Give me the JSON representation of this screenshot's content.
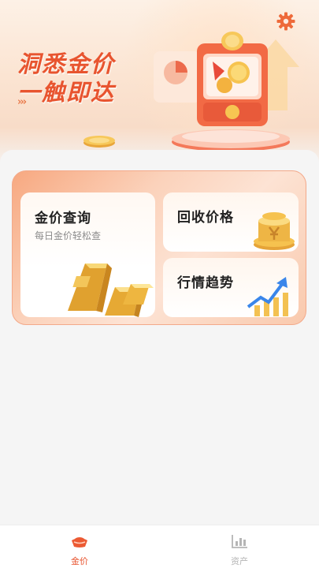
{
  "hero": {
    "title_line1": "洞悉金价",
    "title_line2": "一触即达",
    "arrows": "›››"
  },
  "tiles": {
    "gold_price": {
      "title": "金价查询",
      "subtitle": "每日金价轻松查"
    },
    "recycle": {
      "title": "回收价格"
    },
    "trend": {
      "title": "行情趋势"
    }
  },
  "tabbar": {
    "tabs": [
      {
        "label": "金价",
        "icon": "gold-ingot-icon",
        "active": true
      },
      {
        "label": "资产",
        "icon": "bar-chart-icon",
        "active": false
      }
    ]
  },
  "colors": {
    "accent": "#e8542f",
    "tab_active": "#e8542f",
    "tab_inactive": "#b5b5b5"
  }
}
